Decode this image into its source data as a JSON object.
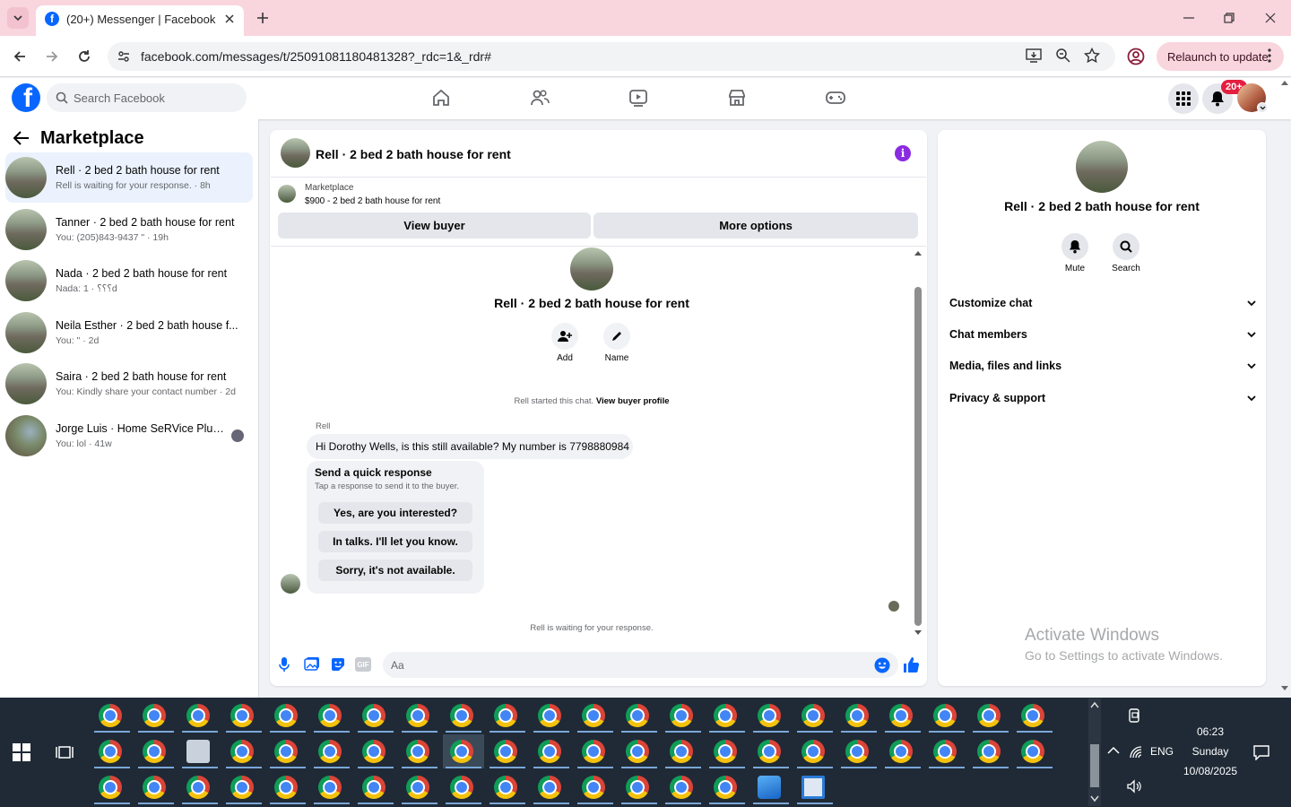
{
  "browser": {
    "tab_title": "(20+) Messenger | Facebook",
    "url": "facebook.com/messages/t/25091081180481328?_rdc=1&_rdr#",
    "relaunch_label": "Relaunch to update"
  },
  "fb": {
    "search_placeholder": "Search Facebook",
    "notification_badge": "20+"
  },
  "left": {
    "title": "Marketplace",
    "conversations": [
      {
        "name": "Rell · 2 bed 2 bath house for rent",
        "sub": "Rell is waiting for your response. · 8h"
      },
      {
        "name": "Tanner · 2 bed 2 bath house for rent",
        "sub": "You: (205)843-9437 \" · 19h"
      },
      {
        "name": "Nada · 2 bed 2 bath house for rent",
        "sub": "Nada: ؟؟؟ · 1d"
      },
      {
        "name": "Neila Esther · 2 bed 2 bath house f...",
        "sub": "You: \" · 2d"
      },
      {
        "name": "Saira · 2 bed 2 bath house for rent",
        "sub": "You: Kindly share your contact number · 2d"
      },
      {
        "name": "Jorge Luis · Home SeRVice PluM...",
        "sub": "You: lol · 41w"
      }
    ]
  },
  "chat": {
    "header_title": "Rell · 2 bed 2 bath house for rent",
    "listing_source": "Marketplace",
    "listing_text": "$900 - 2 bed 2 bath house for rent",
    "view_buyer": "View buyer",
    "more_options": "More options",
    "center_title": "Rell · 2 bed 2 bath house for rent",
    "add_label": "Add",
    "name_label": "Name",
    "started_text": "Rell started this chat.",
    "view_profile": "View buyer profile",
    "sender": "Rell",
    "message": "Hi Dorothy Wells, is this still available? My number is 7798880984",
    "quick_title": "Send a quick response",
    "quick_sub": "Tap a response to send it to the buyer.",
    "quick_options": [
      "Yes, are you interested?",
      "In talks. I'll let you know.",
      "Sorry, it's not available."
    ],
    "waiting": "Rell is waiting for your response.",
    "input_placeholder": "Aa"
  },
  "right": {
    "title": "Rell · 2 bed 2 bath house for rent",
    "mute": "Mute",
    "search": "Search",
    "sections": [
      "Customize chat",
      "Chat members",
      "Media, files and links",
      "Privacy & support"
    ],
    "watermark_title": "Activate Windows",
    "watermark_sub": "Go to Settings to activate Windows."
  },
  "taskbar": {
    "time": "06:23",
    "day": "Sunday",
    "date": "10/08/2025",
    "lang": "ENG"
  },
  "colors": {
    "accent": "#0866ff",
    "info_purple": "#8a2be2",
    "tab_bar": "#f9d5de",
    "taskbar": "#1f2a36"
  }
}
